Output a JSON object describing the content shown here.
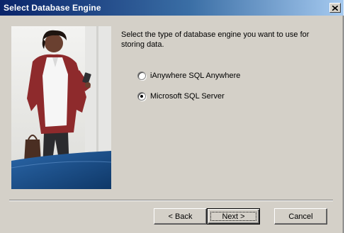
{
  "window": {
    "title": "Select Database Engine",
    "close_icon": "close-x-icon"
  },
  "content": {
    "description": "Select the type of database engine you want to use for storing data."
  },
  "options": [
    {
      "label": "iAnywhere SQL Anywhere",
      "selected": false
    },
    {
      "label": "Microsoft SQL Server",
      "selected": true
    }
  ],
  "buttons": {
    "back": "< Back",
    "next": "Next >",
    "cancel": "Cancel"
  },
  "colors": {
    "title_bar_start": "#0a246a",
    "title_bar_end": "#a6caf0",
    "dialog_bg": "#d4d0c8",
    "banner_wave": "#1e4f86"
  }
}
